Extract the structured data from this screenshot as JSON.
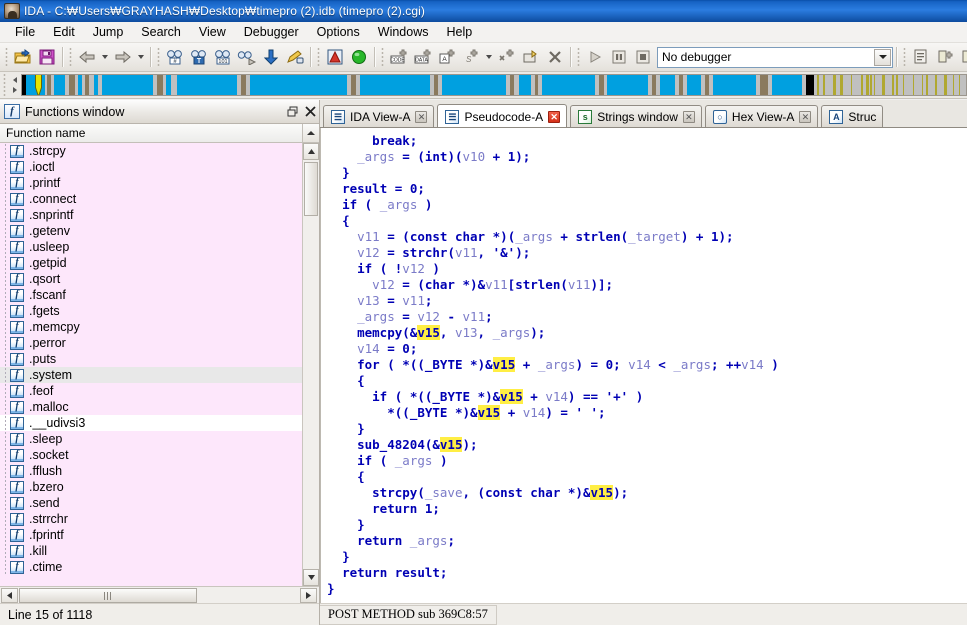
{
  "window": {
    "title": "IDA - C:\\Users\\GRAYHASH\\Desktop\\timepro (2).idb (timepro (2).cgi)",
    "title_display": "IDA - C:₩Users₩GRAYHASH₩Desktop₩timepro (2).idb (timepro (2).cgi)",
    "app_icon": "ida-app-icon"
  },
  "menu": {
    "items": [
      {
        "label": "File"
      },
      {
        "label": "Edit"
      },
      {
        "label": "Jump"
      },
      {
        "label": "Search"
      },
      {
        "label": "View"
      },
      {
        "label": "Debugger"
      },
      {
        "label": "Options"
      },
      {
        "label": "Windows"
      },
      {
        "label": "Help"
      }
    ]
  },
  "toolbar": {
    "debugger_select": {
      "value": "No debugger"
    },
    "buttons": [
      {
        "name": "open-file-icon",
        "glyph": "folder"
      },
      {
        "name": "save-file-icon",
        "glyph": "floppy"
      },
      {
        "name": "navigate-back-icon",
        "glyph": "arrow-left"
      },
      {
        "name": "navigate-back-dropdown-icon",
        "glyph": "caret"
      },
      {
        "name": "navigate-forward-icon",
        "glyph": "arrow-right"
      },
      {
        "name": "navigate-forward-dropdown-icon",
        "glyph": "caret"
      },
      {
        "name": "jump-to-address-icon",
        "glyph": "binoc-hash"
      },
      {
        "name": "search-text-icon",
        "glyph": "binoc-text"
      },
      {
        "name": "search-sequence-icon",
        "glyph": "binoc-101"
      },
      {
        "name": "search-next-icon",
        "glyph": "binoc-next"
      },
      {
        "name": "jump-down-icon",
        "glyph": "arrow-down-blue"
      },
      {
        "name": "producer-icon",
        "glyph": "pencil-lock"
      },
      {
        "name": "warning-icon",
        "glyph": "red-triangle"
      },
      {
        "name": "run-analysis-icon",
        "glyph": "green-ball"
      },
      {
        "name": "make-code-icon",
        "glyph": "code-plus"
      },
      {
        "name": "make-data-icon",
        "glyph": "data-plus"
      },
      {
        "name": "make-ascii-icon",
        "glyph": "ascii-plus"
      },
      {
        "name": "make-struct-icon",
        "glyph": "struct-plus"
      },
      {
        "name": "make-struct-dropdown-icon",
        "glyph": "caret"
      },
      {
        "name": "make-array-icon",
        "glyph": "array-plus"
      },
      {
        "name": "undefine-icon",
        "glyph": "undefine"
      },
      {
        "name": "delete-icon",
        "glyph": "x-mark"
      },
      {
        "name": "run-debugger-icon",
        "glyph": "play"
      },
      {
        "name": "pause-debugger-icon",
        "glyph": "pause"
      },
      {
        "name": "stop-debugger-icon",
        "glyph": "stop"
      },
      {
        "name": "debugger-options-icon",
        "glyph": "list-doc"
      },
      {
        "name": "attach-process-icon",
        "glyph": "attach-plus"
      },
      {
        "name": "detach-process-icon",
        "glyph": "detach-x"
      }
    ]
  },
  "navigator": {
    "marker_color": "#e8e400",
    "code_color": "#00a0e0",
    "data_color": "#b0a830",
    "gap_color": "#c0c0c0",
    "segment_color": "#8a7a5e",
    "segments": [
      {
        "left_pct": 0.0,
        "width_pct": 0.45,
        "color": "#000000"
      },
      {
        "left_pct": 0.45,
        "width_pct": 2.0,
        "color": "#00a0e0"
      },
      {
        "left_pct": 2.6,
        "width_pct": 0.5,
        "color": "#8a7a5e"
      },
      {
        "left_pct": 3.4,
        "width_pct": 1.2,
        "color": "#00a0e0"
      },
      {
        "left_pct": 5.0,
        "width_pct": 0.6,
        "color": "#8a7a5e"
      },
      {
        "left_pct": 5.9,
        "width_pct": 0.45,
        "color": "#00a0e0"
      },
      {
        "left_pct": 6.7,
        "width_pct": 0.45,
        "color": "#8a7a5e"
      },
      {
        "left_pct": 7.6,
        "width_pct": 0.45,
        "color": "#00a0e0"
      },
      {
        "left_pct": 8.5,
        "width_pct": 5.4,
        "color": "#00a0e0"
      },
      {
        "left_pct": 14.3,
        "width_pct": 0.6,
        "color": "#8a7a5e"
      },
      {
        "left_pct": 15.3,
        "width_pct": 0.5,
        "color": "#00a0e0"
      },
      {
        "left_pct": 16.4,
        "width_pct": 6.4,
        "color": "#00a0e0"
      },
      {
        "left_pct": 23.2,
        "width_pct": 0.5,
        "color": "#8a7a5e"
      },
      {
        "left_pct": 24.2,
        "width_pct": 10.2,
        "color": "#00a0e0"
      },
      {
        "left_pct": 34.9,
        "width_pct": 0.45,
        "color": "#8a7a5e"
      },
      {
        "left_pct": 35.8,
        "width_pct": 7.4,
        "color": "#00a0e0"
      },
      {
        "left_pct": 43.6,
        "width_pct": 0.45,
        "color": "#8a7a5e"
      },
      {
        "left_pct": 44.5,
        "width_pct": 6.8,
        "color": "#00a0e0"
      },
      {
        "left_pct": 51.7,
        "width_pct": 0.45,
        "color": "#8a7a5e"
      },
      {
        "left_pct": 52.6,
        "width_pct": 1.3,
        "color": "#00a0e0"
      },
      {
        "left_pct": 54.3,
        "width_pct": 0.4,
        "color": "#8a7a5e"
      },
      {
        "left_pct": 55.1,
        "width_pct": 5.6,
        "color": "#00a0e0"
      },
      {
        "left_pct": 61.1,
        "width_pct": 0.55,
        "color": "#8a7a5e"
      },
      {
        "left_pct": 62.0,
        "width_pct": 4.3,
        "color": "#00a0e0"
      },
      {
        "left_pct": 66.7,
        "width_pct": 0.5,
        "color": "#8a7a5e"
      },
      {
        "left_pct": 67.6,
        "width_pct": 1.6,
        "color": "#00a0e0"
      },
      {
        "left_pct": 69.6,
        "width_pct": 0.4,
        "color": "#8a7a5e"
      },
      {
        "left_pct": 70.4,
        "width_pct": 1.5,
        "color": "#00a0e0"
      },
      {
        "left_pct": 72.3,
        "width_pct": 0.5,
        "color": "#8a7a5e"
      },
      {
        "left_pct": 73.2,
        "width_pct": 4.6,
        "color": "#00a0e0"
      },
      {
        "left_pct": 78.2,
        "width_pct": 0.8,
        "color": "#8a7a5e"
      },
      {
        "left_pct": 79.4,
        "width_pct": 3.2,
        "color": "#00a0e0"
      },
      {
        "left_pct": 83.0,
        "width_pct": 0.9,
        "color": "#000000"
      }
    ]
  },
  "functions_panel": {
    "title": "Functions window",
    "title_icon": "function-window-icon",
    "maximize_icon": "restore-icon",
    "close_icon": "close-icon",
    "column_header": "Function name",
    "status": "Line 15 of 1118",
    "rows": [
      {
        "name": ".strcpy",
        "state": "normal"
      },
      {
        "name": ".ioctl",
        "state": "normal"
      },
      {
        "name": ".printf",
        "state": "normal"
      },
      {
        "name": ".connect",
        "state": "normal"
      },
      {
        "name": ".snprintf",
        "state": "normal"
      },
      {
        "name": ".getenv",
        "state": "normal"
      },
      {
        "name": ".usleep",
        "state": "normal"
      },
      {
        "name": ".getpid",
        "state": "normal"
      },
      {
        "name": ".qsort",
        "state": "normal"
      },
      {
        "name": ".fscanf",
        "state": "normal"
      },
      {
        "name": ".fgets",
        "state": "normal"
      },
      {
        "name": ".memcpy",
        "state": "normal"
      },
      {
        "name": ".perror",
        "state": "normal"
      },
      {
        "name": ".puts",
        "state": "normal"
      },
      {
        "name": ".system",
        "state": "selected"
      },
      {
        "name": ".feof",
        "state": "normal"
      },
      {
        "name": ".malloc",
        "state": "normal"
      },
      {
        "name": ".__udivsi3",
        "state": "alt"
      },
      {
        "name": ".sleep",
        "state": "normal"
      },
      {
        "name": ".socket",
        "state": "normal"
      },
      {
        "name": ".fflush",
        "state": "normal"
      },
      {
        "name": ".bzero",
        "state": "normal"
      },
      {
        "name": ".send",
        "state": "normal"
      },
      {
        "name": ".strrchr",
        "state": "normal"
      },
      {
        "name": ".fprintf",
        "state": "normal"
      },
      {
        "name": ".kill",
        "state": "normal"
      },
      {
        "name": ".ctime",
        "state": "normal"
      }
    ]
  },
  "tabs": [
    {
      "label": "IDA View-A",
      "icon": "ida-view-icon",
      "active": false,
      "close": "grey"
    },
    {
      "label": "Pseudocode-A",
      "icon": "pseudocode-icon",
      "active": true,
      "close": "red"
    },
    {
      "label": "Strings window",
      "icon": "strings-icon",
      "active": false,
      "close": "grey"
    },
    {
      "label": "Hex View-A",
      "icon": "hex-view-icon",
      "active": false,
      "close": "grey"
    },
    {
      "label": "Struc",
      "icon": "structures-icon",
      "active": false,
      "close": "none"
    }
  ],
  "pseudocode": {
    "highlight_token": "v15",
    "highlight_color": "#ffee44",
    "status": "POST METHOD sub 369C8:57",
    "lines": [
      "      break;",
      "    _args = (int)(v10 + 1);",
      "  }",
      "  result = 0;",
      "  if ( _args )",
      "  {",
      "    v11 = (const char *)(_args + strlen(_target) + 1);",
      "    v12 = strchr(v11, '&');",
      "    if ( !v12 )",
      "      v12 = (char *)&v11[strlen(v11)];",
      "    v13 = v11;",
      "    _args = v12 - v11;",
      "    memcpy(&v15, v13, _args);",
      "    v14 = 0;",
      "    for ( *((_BYTE *)&v15 + _args) = 0; v14 < _args; ++v14 )",
      "    {",
      "      if ( *((_BYTE *)&v15 + v14) == '+' )",
      "        *((_BYTE *)&v15 + v14) = ' ';",
      "    }",
      "    sub_48204(&v15);",
      "    if ( _args )",
      "    {",
      "      strcpy(_save, (const char *)&v15);",
      "      return 1;",
      "    }",
      "    return _args;",
      "  }",
      "  return result;",
      "}"
    ]
  }
}
